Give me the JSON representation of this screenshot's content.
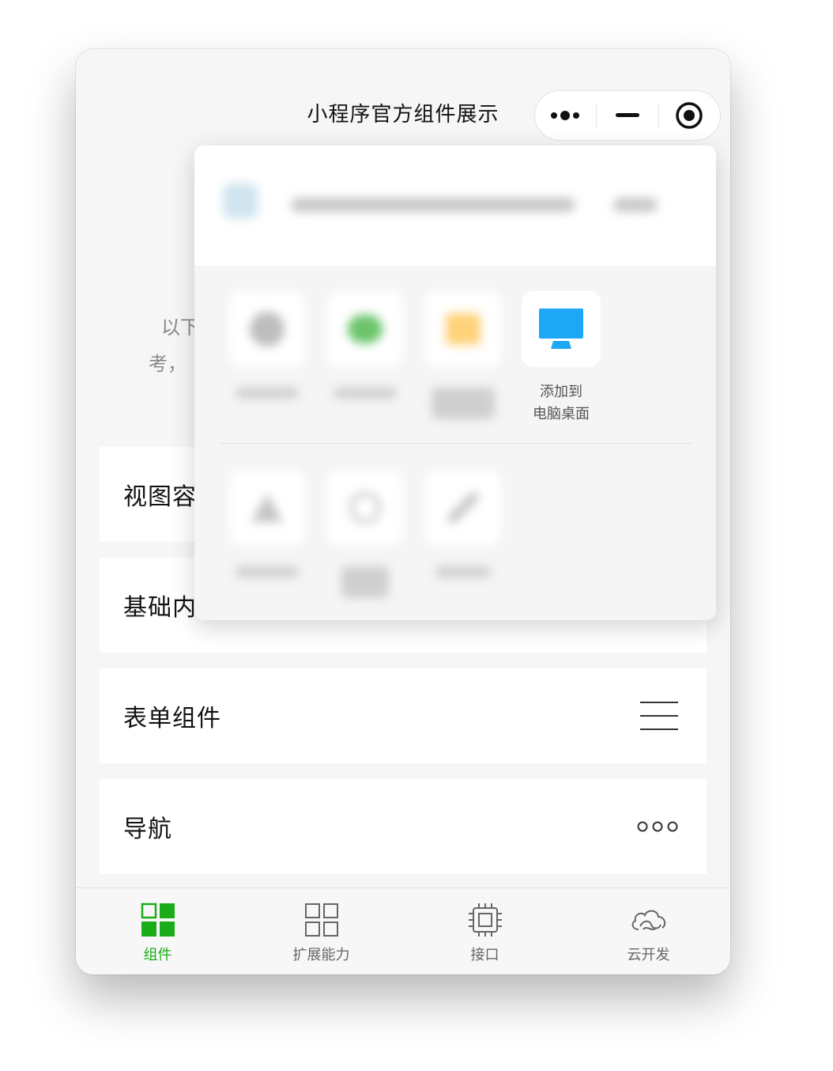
{
  "nav": {
    "title": "小程序官方组件展示"
  },
  "background": {
    "intro_line1": "以下",
    "intro_line2": "考，"
  },
  "cards": [
    {
      "label": "视图容器"
    },
    {
      "label": "基础内容"
    },
    {
      "label": "表单组件",
      "icon": "menu-lines-icon"
    },
    {
      "label": "导航",
      "icon": "three-dots-icon"
    }
  ],
  "popup": {
    "visible_item_label": "添加到\n电脑桌面",
    "visible_item_icon": "desktop-monitor-icon"
  },
  "tabbar": {
    "tabs": [
      {
        "label": "组件",
        "active": true,
        "icon": "components-grid-icon"
      },
      {
        "label": "扩展能力",
        "active": false,
        "icon": "extension-grid-icon"
      },
      {
        "label": "接口",
        "active": false,
        "icon": "chip-icon"
      },
      {
        "label": "云开发",
        "active": false,
        "icon": "cloud-icon"
      }
    ]
  },
  "colors": {
    "accent_green": "#1aad19",
    "desktop_blue": "#1ea7f5",
    "background": "#f6f6f6"
  }
}
